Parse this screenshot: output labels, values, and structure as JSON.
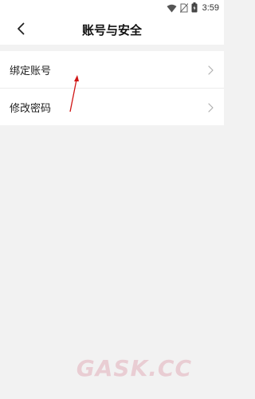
{
  "status_bar": {
    "time": "3:59",
    "icons": [
      "wifi-icon",
      "no-sim-icon",
      "battery-icon"
    ]
  },
  "header": {
    "title": "账号与安全",
    "back_icon": "chevron-left-icon"
  },
  "settings": {
    "items": [
      {
        "label": "绑定账号",
        "icon": "chevron-right-icon"
      },
      {
        "label": "修改密码",
        "icon": "chevron-right-icon"
      }
    ]
  },
  "watermark": {
    "text": "GASK.CC"
  },
  "colors": {
    "background": "#f2f2f2",
    "surface": "#ffffff",
    "annotation": "#d01515",
    "watermark": "#d98a9a"
  }
}
